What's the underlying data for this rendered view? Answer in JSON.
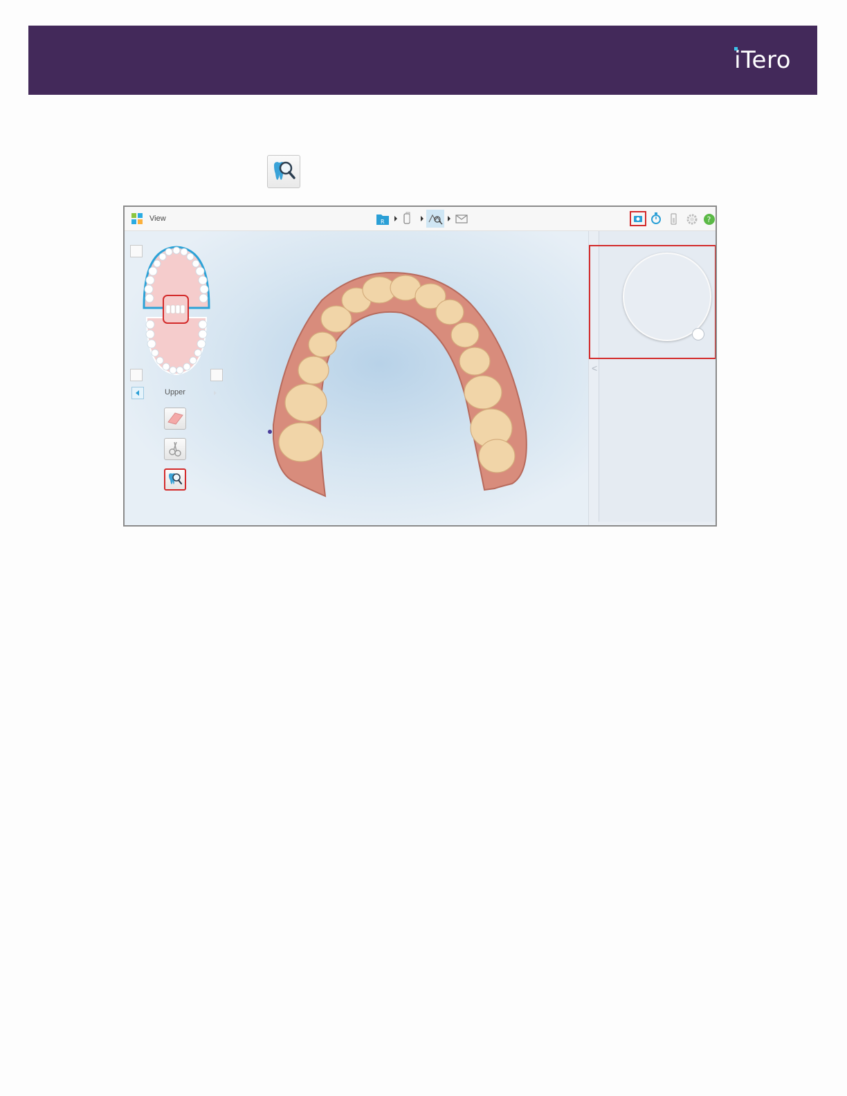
{
  "brand": {
    "logo_text": "iTero"
  },
  "window": {
    "title": "View"
  },
  "toolbar": {
    "workflow_steps": [
      "rx-icon",
      "scan-icon",
      "view-icon",
      "send-icon"
    ],
    "active_step": "view-icon",
    "right_icons": [
      "camera-icon",
      "timer-icon",
      "battery-icon",
      "settings-icon",
      "help-icon"
    ]
  },
  "jaw_panel": {
    "arch_label": "Upper"
  },
  "tools": [
    "eraser-icon",
    "trim-icon",
    "review-tool-icon"
  ],
  "colors": {
    "banner": "#43295a",
    "accent": "#2a9fd6",
    "highlight": "#d32a2a",
    "help": "#5bb946"
  }
}
